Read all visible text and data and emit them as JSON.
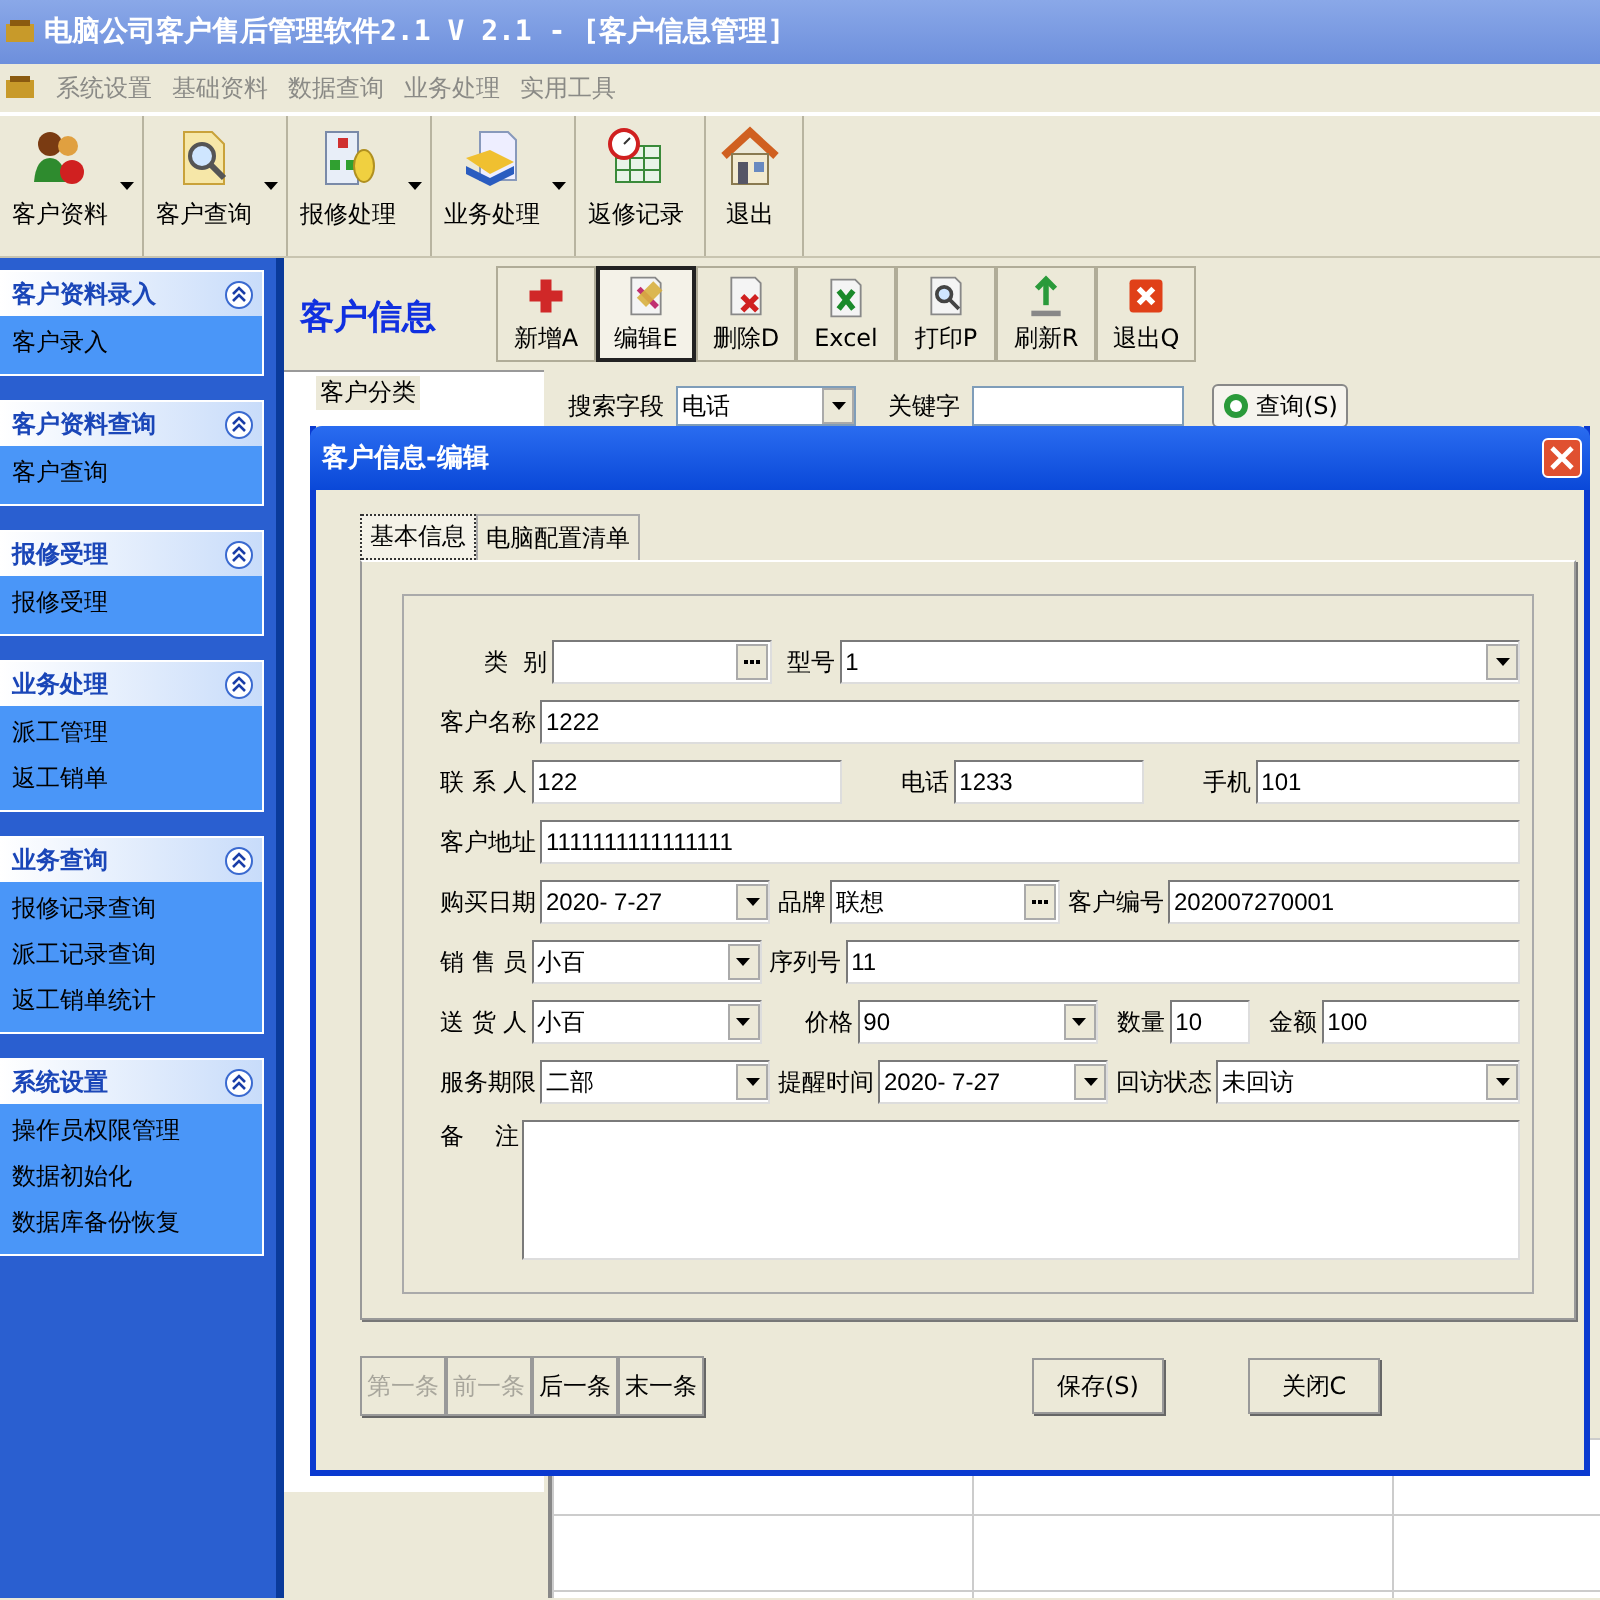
{
  "window": {
    "title": "电脑公司客户售后管理软件2.1 V 2.1 - [客户信息管理]"
  },
  "menu": [
    {
      "label": "系统设置",
      "disabled": true
    },
    {
      "label": "基础资料",
      "disabled": true
    },
    {
      "label": "数据查询",
      "disabled": true
    },
    {
      "label": "业务处理",
      "disabled": true
    },
    {
      "label": "实用工具",
      "disabled": true
    }
  ],
  "toolbar": [
    {
      "label": "客户资料",
      "kind": "people",
      "dropdown": true
    },
    {
      "label": "客户查询",
      "kind": "search",
      "dropdown": true
    },
    {
      "label": "报修处理",
      "kind": "chart",
      "dropdown": true
    },
    {
      "label": "业务处理",
      "kind": "document",
      "dropdown": true
    },
    {
      "label": "返修记录",
      "kind": "table",
      "dropdown": false
    },
    {
      "label": "退出",
      "kind": "home",
      "dropdown": false
    }
  ],
  "sidebar": {
    "groups": [
      {
        "title": "客户资料录入",
        "expanded": true,
        "items": [
          "客户录入"
        ]
      },
      {
        "title": "客户资料查询",
        "expanded": true,
        "items": [
          "客户查询"
        ]
      },
      {
        "title": "报修受理",
        "expanded": true,
        "items": [
          "报修受理"
        ]
      },
      {
        "title": "业务处理",
        "expanded": true,
        "items": [
          "派工管理",
          "返工销单"
        ]
      },
      {
        "title": "业务查询",
        "expanded": true,
        "items": [
          "报修记录查询",
          "派工记录查询",
          "返工销单统计"
        ]
      },
      {
        "title": "系统设置",
        "expanded": true,
        "items": [
          "操作员权限管理",
          "数据初始化",
          "数据库备份恢复"
        ]
      }
    ]
  },
  "page": {
    "title": "客户信息",
    "buttons": [
      {
        "label": "新增A",
        "kind": "add",
        "selected": false
      },
      {
        "label": "编辑E",
        "kind": "edit",
        "selected": true
      },
      {
        "label": "删除D",
        "kind": "delete",
        "selected": false
      },
      {
        "label": "Excel",
        "kind": "excel",
        "selected": false
      },
      {
        "label": "打印P",
        "kind": "print",
        "selected": false
      },
      {
        "label": "刷新R",
        "kind": "refresh",
        "selected": false
      },
      {
        "label": "退出Q",
        "kind": "exit",
        "selected": false
      }
    ],
    "tree": [
      {
        "label": "客户分类"
      }
    ],
    "search": {
      "field_label": "搜索字段",
      "field_value": "电话",
      "keyword_label": "关键字",
      "button": "查询(S)"
    }
  },
  "dialog": {
    "title": "客户信息-编辑",
    "tabs": [
      {
        "label": "基本信息",
        "selected": true
      },
      {
        "label": "电脑配置清单",
        "selected": false
      }
    ],
    "rows": [
      [
        {
          "label": "类  别",
          "kind": "lookup"
        },
        {
          "label": "型号",
          "kind": "combo",
          "value": "1"
        }
      ],
      [
        {
          "label": "客户名称",
          "kind": "text",
          "value": "1222"
        }
      ],
      [
        {
          "label": "联 系 人",
          "kind": "text",
          "value": "122"
        },
        {
          "label": "电话",
          "kind": "text",
          "value": "1233"
        },
        {
          "label": "手机",
          "kind": "text",
          "value": "101"
        }
      ],
      [
        {
          "label": "客户地址",
          "kind": "text",
          "value": "1111111111111111"
        }
      ],
      [
        {
          "label": "购买日期",
          "kind": "combo",
          "value": "2020- 7-27"
        },
        {
          "label": "品牌",
          "kind": "lookup",
          "value": "联想"
        },
        {
          "label": "客户编号",
          "kind": "text",
          "value": "202007270001"
        }
      ],
      [
        {
          "label": "销 售 员",
          "kind": "combo",
          "value": "小百"
        },
        {
          "label": "序列号",
          "kind": "text",
          "value": "11"
        }
      ],
      [
        {
          "label": "送 货 人",
          "kind": "combo",
          "value": "小百"
        },
        {
          "label": "价格",
          "kind": "combo",
          "value": "90"
        },
        {
          "label": "数量",
          "kind": "text",
          "value": "10"
        },
        {
          "label": "金额",
          "kind": "text",
          "value": "100"
        }
      ],
      [
        {
          "label": "服务期限",
          "kind": "combo",
          "value": "二部"
        },
        {
          "label": "提醒时间",
          "kind": "combo",
          "value": "2020- 7-27"
        },
        {
          "label": "回访状态",
          "kind": "combo",
          "value": "未回访"
        }
      ],
      [
        {
          "label": "备    注",
          "kind": "memo"
        }
      ]
    ],
    "nav_buttons": [
      {
        "label": "第一条",
        "disabled": true
      },
      {
        "label": "前一条",
        "disabled": true
      },
      {
        "label": "后一条",
        "disabled": false
      },
      {
        "label": "末一条",
        "disabled": false
      }
    ],
    "buttons": [
      "保存(S)",
      "关闭C"
    ]
  }
}
